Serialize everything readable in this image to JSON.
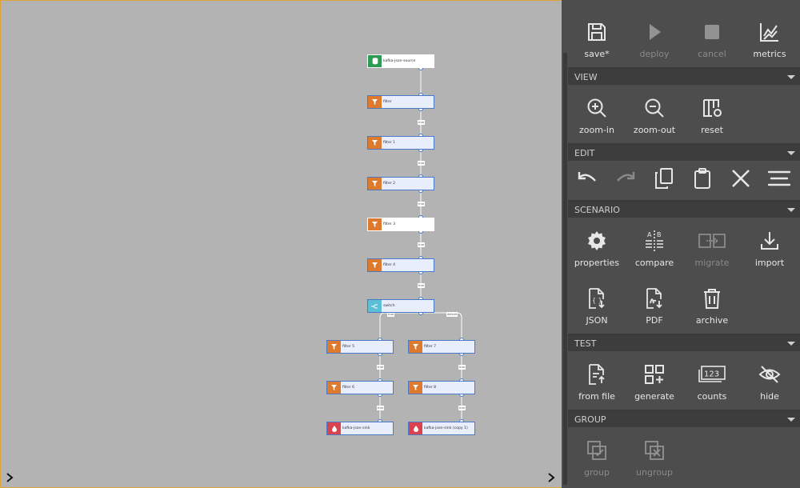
{
  "canvas": {
    "nodes": {
      "source": "kafka-json-source",
      "filter": "filter",
      "filter1": "filter 1",
      "filter2": "filter 2",
      "filter3": "filter 3",
      "filter4": "filter 4",
      "switch": "switch",
      "filter5": "filter 5",
      "filter6": "filter 6",
      "filter7": "filter 7",
      "filter8": "filter 8",
      "sink": "kafka-json-sink",
      "sink_copy": "kafka-json-sink (copy 1)"
    },
    "edge_label": "true",
    "edge_label_left": "true",
    "edge_label_right": "default"
  },
  "toolbar": {
    "save_label": "save*",
    "deploy_label": "deploy",
    "cancel_label": "cancel",
    "metrics_label": "metrics"
  },
  "view": {
    "title": "VIEW",
    "zoom_in_label": "zoom-in",
    "zoom_out_label": "zoom-out",
    "reset_label": "reset"
  },
  "edit": {
    "title": "EDIT"
  },
  "scenario": {
    "title": "SCENARIO",
    "properties_label": "properties",
    "compare_label": "compare",
    "migrate_label": "migrate",
    "import_label": "import",
    "json_label": "JSON",
    "pdf_label": "PDF",
    "archive_label": "archive"
  },
  "test": {
    "title": "TEST",
    "from_file_label": "from file",
    "generate_label": "generate",
    "counts_label": "counts",
    "hide_label": "hide"
  },
  "group": {
    "title": "GROUP",
    "group_label": "group",
    "ungroup_label": "ungroup"
  },
  "colors": {
    "canvas_bg": "#b3b3b3",
    "panel_bg": "#4d4d4d",
    "source_green": "#2e9b55",
    "filter_orange": "#dd7a2d",
    "switch_teal": "#5bbfd6",
    "sink_red": "#d8434d",
    "selection_border": "#e1a337"
  }
}
